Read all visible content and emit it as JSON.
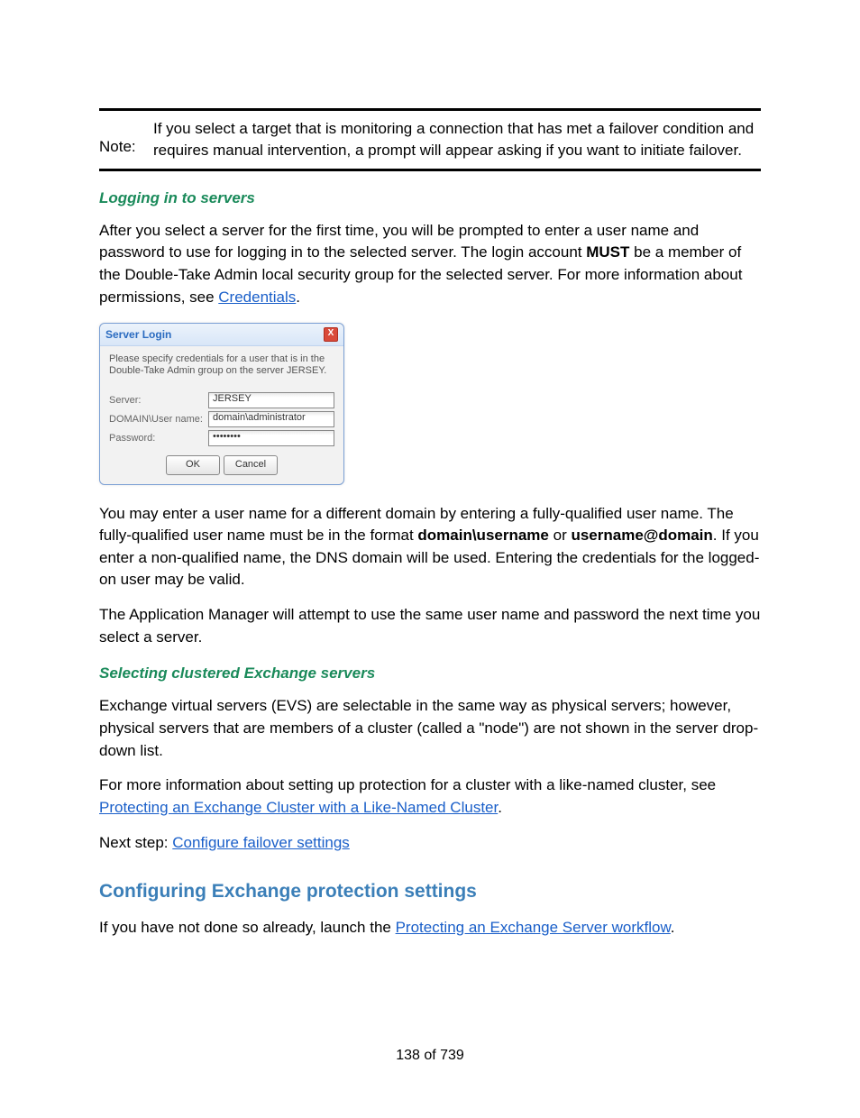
{
  "note": {
    "label": "Note:",
    "text": "If you select a target that is monitoring a connection that has met a failover condition and requires manual intervention, a prompt will appear asking if you want to initiate failover."
  },
  "section1": {
    "title": "Logging in to servers",
    "p1_a": "After you select a server for the first time, you will be prompted to enter a user name and password to use for logging in to the selected server. The login account ",
    "p1_must": "MUST",
    "p1_b": " be a member of the Double-Take Admin local security group for the selected server. For more information about permissions, see ",
    "p1_link": "Credentials",
    "p1_c": "."
  },
  "dialog": {
    "title": "Server Login",
    "instruction": "Please specify credentials for a user that is in the Double-Take Admin group on the server JERSEY.",
    "server_label": "Server:",
    "server_value": "JERSEY",
    "user_label": "DOMAIN\\User name:",
    "user_value": "domain\\administrator",
    "pass_label": "Password:",
    "pass_value": "••••••••",
    "ok": "OK",
    "cancel": "Cancel",
    "close_x": "X"
  },
  "para2": {
    "a": "You may enter a user name for a different domain by entering a fully-qualified user name. The fully-qualified user name must be in the format ",
    "b1": "domain\\username",
    "b2": " or ",
    "b3": "username@domain",
    "c": ". If you enter a non-qualified name, the DNS domain will be used. Entering the credentials for the logged-on user may be valid."
  },
  "para3": "The Application Manager will attempt to use the same user name and password the next time you select a server.",
  "section2": {
    "title": "Selecting clustered Exchange servers",
    "p1": "Exchange virtual servers (EVS) are selectable in the same way as physical servers; however, physical servers that are members of a cluster (called a \"node\") are not shown in the server drop-down list.",
    "p2_a": "For more information about setting up protection for a cluster with a like-named cluster, see ",
    "p2_link": "Protecting an Exchange Cluster with a Like-Named Cluster",
    "p2_b": ".",
    "p3_a": "Next step: ",
    "p3_link": "Configure failover settings"
  },
  "h2": "Configuring Exchange protection settings",
  "para4": {
    "a": "If you have not done so already, launch the ",
    "link": "Protecting an Exchange Server workflow",
    "b": "."
  },
  "pagenum": "138 of 739"
}
